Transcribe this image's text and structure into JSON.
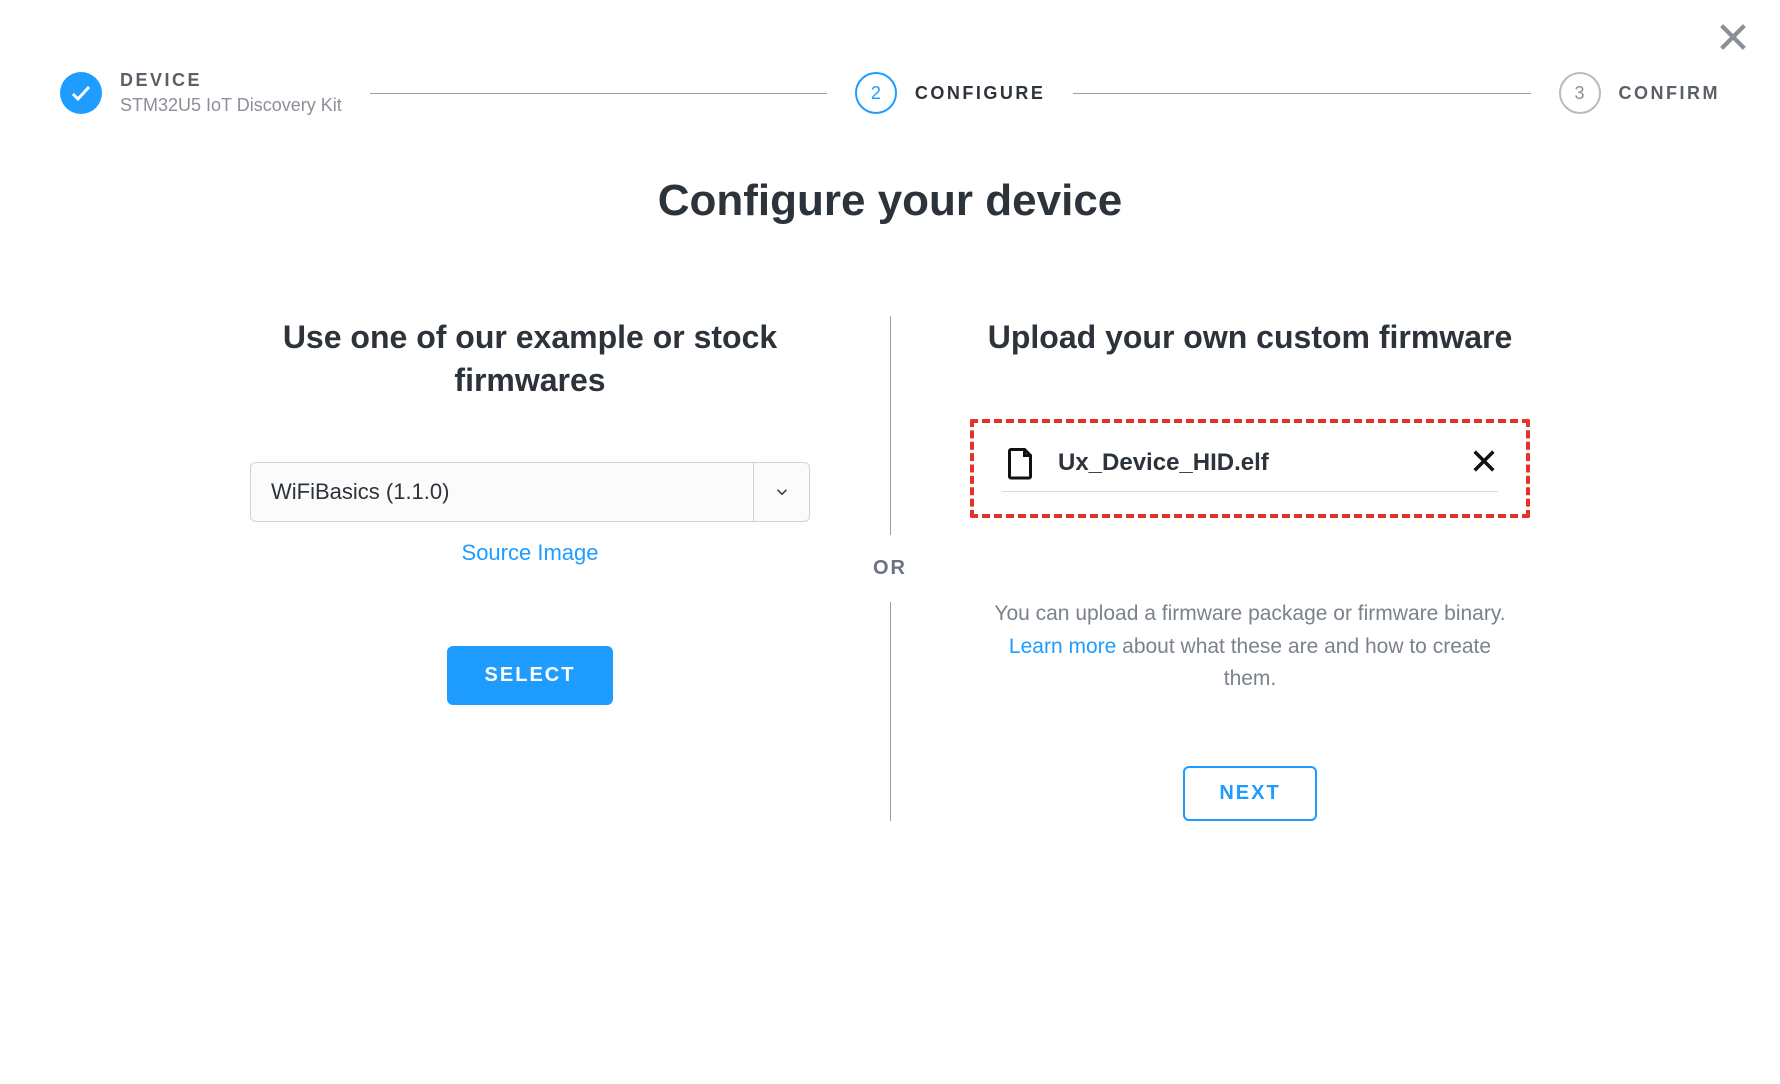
{
  "stepper": {
    "step1": {
      "title": "DEVICE",
      "subtitle": "STM32U5 IoT Discovery Kit"
    },
    "step2": {
      "number": "2",
      "title": "CONFIGURE"
    },
    "step3": {
      "number": "3",
      "title": "CONFIRM"
    }
  },
  "heading": "Configure your device",
  "left": {
    "heading": "Use one of our example or stock firmwares",
    "dropdown_value": "WiFiBasics (1.1.0)",
    "source_image_link": "Source Image",
    "select_button": "SELECT"
  },
  "divider_label": "OR",
  "right": {
    "heading": "Upload your own custom firmware",
    "uploaded_filename": "Ux_Device_HID.elf",
    "help_pre": "You can upload a firmware package or firmware binary. ",
    "help_link": "Learn more",
    "help_post": " about what these are and how to create them.",
    "next_button": "NEXT"
  }
}
